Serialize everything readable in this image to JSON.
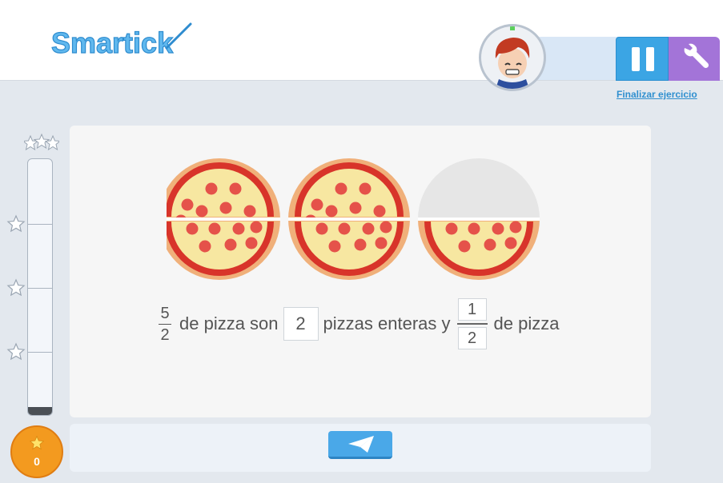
{
  "app": {
    "logo_text": "Smartick",
    "avatar_label": "student avatar"
  },
  "header": {
    "pause_icon": "pause-icon",
    "tools_icon": "wrench-icon",
    "finish_link": "Finalizar ejercicio"
  },
  "progress": {
    "level": 0.03,
    "top_icon": "three-stars-icon",
    "milestone_icon": "star-outline-icon"
  },
  "coins": {
    "count": "0",
    "icon": "star-icon"
  },
  "exercise": {
    "given_numerator": "5",
    "given_denominator": "2",
    "text_1": "de pizza son",
    "whole_answer": "2",
    "text_2": "pizzas enteras y",
    "frac_numerator": "1",
    "frac_denominator": "2",
    "text_3": "de pizza",
    "pizzas": [
      {
        "halves_shown": 2
      },
      {
        "halves_shown": 2
      },
      {
        "halves_shown": 1
      }
    ]
  },
  "submit": {
    "icon": "paper-plane-icon"
  },
  "colors": {
    "accent_blue": "#3ba5e4",
    "accent_purple": "#a374d8",
    "coin_orange": "#f39a1f",
    "pizza_crust": "#f0b07a",
    "pizza_sauce": "#d8342a",
    "pizza_cheese": "#f7e7a1",
    "pepperoni": "#e5524a"
  }
}
